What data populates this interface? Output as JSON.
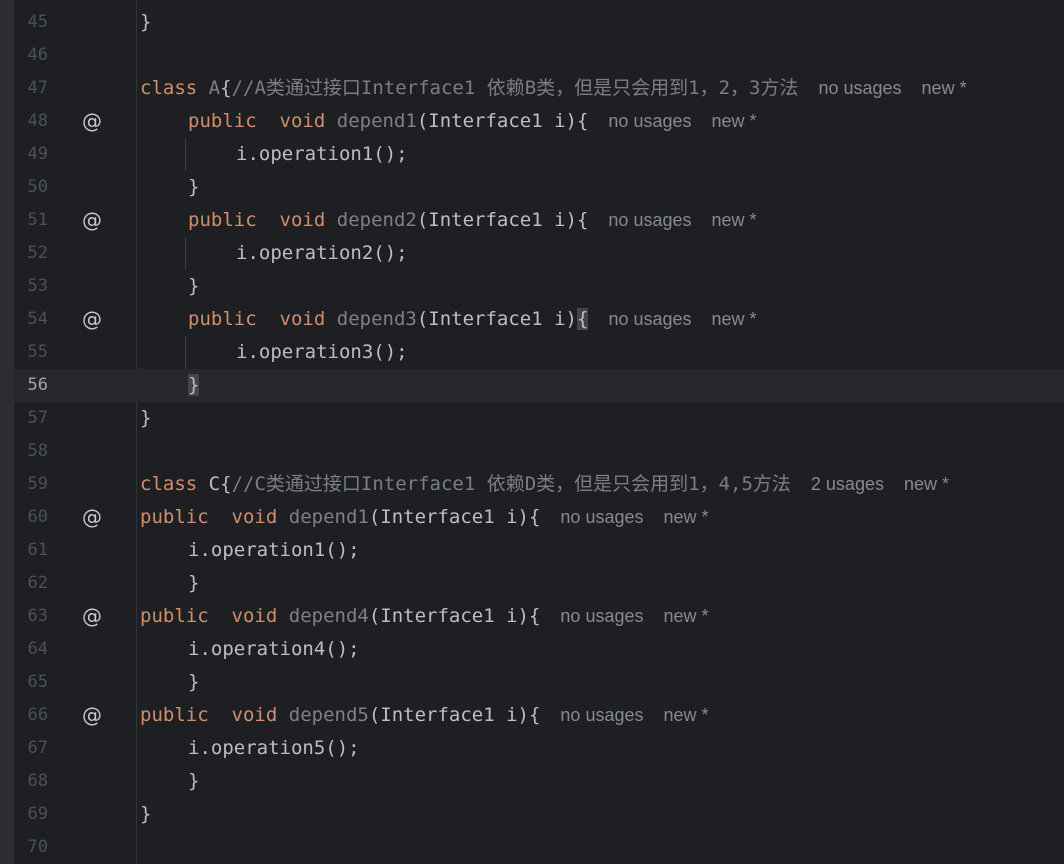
{
  "editor": {
    "lines": {
      "l45": {
        "num": "45",
        "close": "}"
      },
      "l46": {
        "num": "46"
      },
      "l47": {
        "num": "47",
        "kw": "class",
        "name": "A",
        "brace": "{",
        "comment": "//A类通过接口Interface1 依赖B类，但是只会用到1，2，3方法",
        "hint1": "no usages",
        "hint2": "new *"
      },
      "l48": {
        "num": "48",
        "at": "@",
        "kw1": "public",
        "kw2": "void",
        "fn": "depend1",
        "args": "(Interface1 i){",
        "hint1": "no usages",
        "hint2": "new *"
      },
      "l49": {
        "num": "49",
        "stmt": "i.operation1();"
      },
      "l50": {
        "num": "50",
        "close": "}"
      },
      "l51": {
        "num": "51",
        "at": "@",
        "kw1": "public",
        "kw2": "void",
        "fn": "depend2",
        "args": "(Interface1 i){",
        "hint1": "no usages",
        "hint2": "new *"
      },
      "l52": {
        "num": "52",
        "stmt": "i.operation2();"
      },
      "l53": {
        "num": "53",
        "close": "}"
      },
      "l54": {
        "num": "54",
        "at": "@",
        "kw1": "public",
        "kw2": "void",
        "fn": "depend3",
        "args": "(Interface1 i)",
        "brace": "{",
        "hint1": "no usages",
        "hint2": "new *"
      },
      "l55": {
        "num": "55",
        "stmt": "i.operation3();"
      },
      "l56": {
        "num": "56",
        "close": "}"
      },
      "l57": {
        "num": "57",
        "close": "}"
      },
      "l58": {
        "num": "58"
      },
      "l59": {
        "num": "59",
        "kw": "class",
        "name": "C",
        "brace": "{",
        "comment": "//C类通过接口Interface1 依赖D类，但是只会用到1，4,5方法",
        "hint1": "2 usages",
        "hint2": "new *"
      },
      "l60": {
        "num": "60",
        "at": "@",
        "kw1": "public",
        "kw2": "void",
        "fn": "depend1",
        "args": "(Interface1 i){",
        "hint1": "no usages",
        "hint2": "new *"
      },
      "l61": {
        "num": "61",
        "stmt": "i.operation1();"
      },
      "l62": {
        "num": "62",
        "close": "}"
      },
      "l63": {
        "num": "63",
        "at": "@",
        "kw1": "public",
        "kw2": "void",
        "fn": "depend4",
        "args": "(Interface1 i){",
        "hint1": "no usages",
        "hint2": "new *"
      },
      "l64": {
        "num": "64",
        "stmt": "i.operation4();"
      },
      "l65": {
        "num": "65",
        "close": "}"
      },
      "l66": {
        "num": "66",
        "at": "@",
        "kw1": "public",
        "kw2": "void",
        "fn": "depend5",
        "args": "(Interface1 i){",
        "hint1": "no usages",
        "hint2": "new *"
      },
      "l67": {
        "num": "67",
        "stmt": "i.operation5();"
      },
      "l68": {
        "num": "68",
        "close": "}"
      },
      "l69": {
        "num": "69",
        "close": "}"
      },
      "l70": {
        "num": "70"
      }
    },
    "colors": {
      "background": "#1e1f22",
      "keyword": "#cf8e6d",
      "identifier": "#bcbec4",
      "unused_method": "#7d8187",
      "comment": "#7a7e85",
      "inlay_hint": "#868a91",
      "current_line": "#26282e"
    },
    "icons": {
      "override_gutter": "at-sign-icon"
    }
  }
}
